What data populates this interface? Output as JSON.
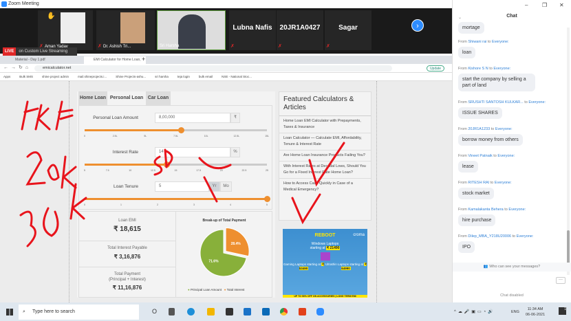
{
  "window": {
    "title": "Zoom Meeting",
    "controls": [
      "–",
      "❐",
      "✕"
    ]
  },
  "participants": [
    {
      "name": "Aman Yadav",
      "hand": true
    },
    {
      "name": "Dr. Ashish Tri..."
    },
    {
      "name": "Sri Harsha"
    },
    {
      "name": "Lubna Nafis"
    },
    {
      "name": "20JR1A0427"
    },
    {
      "name": "Sagar"
    }
  ],
  "live": {
    "badge": "LIVE",
    "text": "on Custom Live Streaming Service ▾"
  },
  "browser": {
    "tabs": [
      "Material - Day 1.pdf",
      "EMI Calculator for Home Loan, Car Loan"
    ],
    "url": "emicalculator.net",
    "update": "Update",
    "bookmarks": [
      "Apps",
      "Bulk SMS",
      "shine project admin",
      "mail.shineprojects.i...",
      "Shine Projects-ashu...",
      "sri harsha",
      "teja login",
      "bulk email",
      "NSE - National Stoc..."
    ]
  },
  "calc": {
    "tabs": [
      "Home Loan",
      "Personal Loan",
      "Car Loan"
    ],
    "active_tab": 1,
    "amount": {
      "label": "Personal Loan Amount",
      "value": "8,00,000",
      "unit": "₹",
      "fraction": 0.53,
      "ticks": [
        "0",
        "2.5L",
        "5L",
        "7.5L",
        "10L",
        "12.5L",
        "15L"
      ]
    },
    "rate": {
      "label": "Interest Rate",
      "value": "14",
      "unit": "%",
      "fraction": 0.45,
      "ticks": [
        "5",
        "7.5",
        "10",
        "12.5",
        "15",
        "17.5",
        "20",
        "22.5",
        "25"
      ]
    },
    "tenure": {
      "label": "Loan Tenure",
      "value": "5",
      "units": [
        "Yr",
        "Mo"
      ],
      "fraction": 1.0,
      "ticks": [
        "0",
        "1",
        "2",
        "3",
        "4",
        "5"
      ]
    },
    "results": {
      "emi_label": "Loan EMI",
      "emi": "₹ 18,615",
      "interest_label": "Total Interest Payable",
      "interest": "₹ 3,16,876",
      "total_label1": "Total Payment",
      "total_label2": "(Principal + Interest)",
      "total": "₹ 11,16,876"
    }
  },
  "chart_data": {
    "type": "pie",
    "title": "Break-up of Total Payment",
    "categories": [
      "Principal Loan Amount",
      "Total Interest"
    ],
    "values": [
      71.6,
      28.4
    ],
    "labels": [
      "71.6%",
      "28.4%"
    ],
    "colors": [
      "#88b03a",
      "#ee8f2f"
    ],
    "legend": "bottom"
  },
  "sidebar": {
    "title": "Featured Calculators & Articles",
    "articles": [
      "Home Loan EMI Calculator with Prepayments, Taxes & Insurance",
      "Loan Calculator — Calculate EMI, Affordability, Tenure & Interest Rate",
      "Are Home Loan Insurance Products Failing You?",
      "With Interest Rates at Decadal Lows, Should You Go for a Fixed Interest Rate Home Loan?",
      "How to Access Cash Quickly in Case of a Medical Emergency?"
    ]
  },
  "ad": {
    "brand": "REBOOT",
    "logo": "croma",
    "l1": "Windows Laptops",
    "l1b": "starting at",
    "p1": "₹ 21490",
    "l2": "Gaming Laptops starting at",
    "p2": "₹ 53490",
    "l3": "Ultrathin Laptops starting at",
    "p3": "₹ 64990",
    "footer": "UP TO 50% OFF ON ACCESSORIES | LONG TERM EMI"
  },
  "chat": {
    "title": "Chat",
    "first_message": "mortage",
    "messages": [
      {
        "from": "Shiwani rai",
        "to": "Everyone:",
        "text": "loan"
      },
      {
        "from": "Kishore S N",
        "to": "Everyone:",
        "text": "start the company by selling a part of land"
      },
      {
        "from": "SRUSHTI SANTOSH KULKAR...",
        "to": "Everyone:",
        "text": "ISSUE SHARES"
      },
      {
        "from": "20JR1A1233",
        "to": "Everyone:",
        "text": "borrow money from others"
      },
      {
        "from": "Vineet Patnaik",
        "to": "Everyone:",
        "text": "lease"
      },
      {
        "from": "RITESH RAI",
        "to": "Everyone:",
        "text": "stock market"
      },
      {
        "from": "Kamalakanta Behera",
        "to": "Everyone:",
        "text": "hire purchase"
      },
      {
        "from": "Dilep_MBA_Y218U20006",
        "to": "Everyone:",
        "text": "IPO"
      }
    ],
    "from_word": "From",
    "to_word": "to",
    "who": "Who can see your messages?",
    "disabled": "Chat disabled"
  },
  "taskbar": {
    "search": "Type here to search",
    "lang": "ENG",
    "time": "11:34 AM",
    "date": "06-06-2021",
    "notif": "1"
  }
}
